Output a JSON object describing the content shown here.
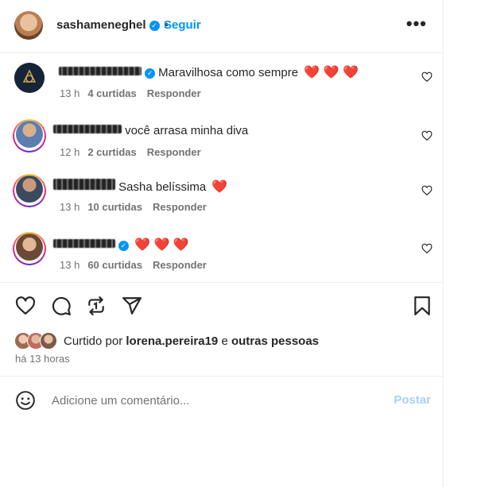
{
  "header": {
    "username": "sashameneghel",
    "separator": "•",
    "follow_label": "Seguir",
    "more_label": "•••"
  },
  "comments": [
    {
      "text": "Maravilhosa como sempre",
      "emoji": "❤️ ❤️ ❤️",
      "time": "13 h",
      "likes": "4 curtidas",
      "reply": "Responder"
    },
    {
      "text": "você arrasa minha diva",
      "emoji": "",
      "time": "12 h",
      "likes": "2 curtidas",
      "reply": "Responder"
    },
    {
      "text": "Sasha belíssima",
      "emoji": "❤️",
      "time": "13 h",
      "likes": "10 curtidas",
      "reply": "Responder"
    },
    {
      "text": "",
      "emoji": "❤️ ❤️ ❤️",
      "time": "13 h",
      "likes": "60 curtidas",
      "reply": "Responder"
    }
  ],
  "likes_summary": {
    "prefix": "Curtido por",
    "user": "lorena.pereira19",
    "connector": "e",
    "others": "outras pessoas"
  },
  "timestamp": "há 13 horas",
  "composer": {
    "placeholder": "Adicione um comentário...",
    "post_label": "Postar"
  },
  "colors": {
    "accent": "#0095f6",
    "post_disabled": "#a6d2f5",
    "heart": "#f0245a"
  }
}
